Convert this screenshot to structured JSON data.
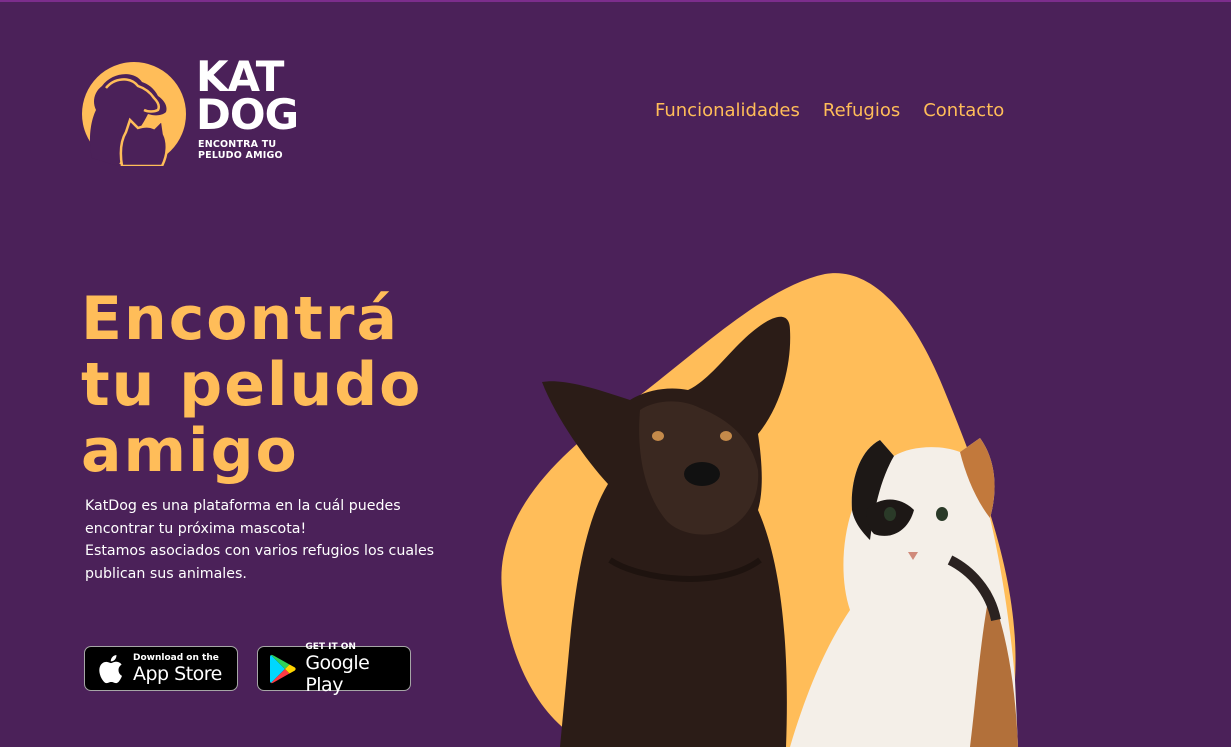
{
  "brand": {
    "name_line1": "KAT",
    "name_line2": "DOG",
    "tagline_line1": "ENCONTRA TU",
    "tagline_line2": "PELUDO AMIGO"
  },
  "nav": {
    "items": [
      {
        "label": "Funcionalidades"
      },
      {
        "label": "Refugios"
      },
      {
        "label": "Contacto"
      }
    ]
  },
  "hero": {
    "title_line1": "Encontrá",
    "title_line2": "tu peludo",
    "title_line3": "amigo",
    "desc_p1": "KatDog es una plataforma en la cuál puedes encontrar tu próxima mascota!",
    "desc_p2": "Estamos asociados con varios refugios los cuales publican sus animales."
  },
  "stores": {
    "app_store": {
      "small": "Download on the",
      "big": "App Store",
      "icon": "apple-icon"
    },
    "google_play": {
      "small": "GET IT ON",
      "big": "Google Play",
      "icon": "google-play-icon"
    }
  },
  "colors": {
    "background": "#4b2159",
    "accent": "#ffbd59",
    "text": "#ffffff"
  }
}
